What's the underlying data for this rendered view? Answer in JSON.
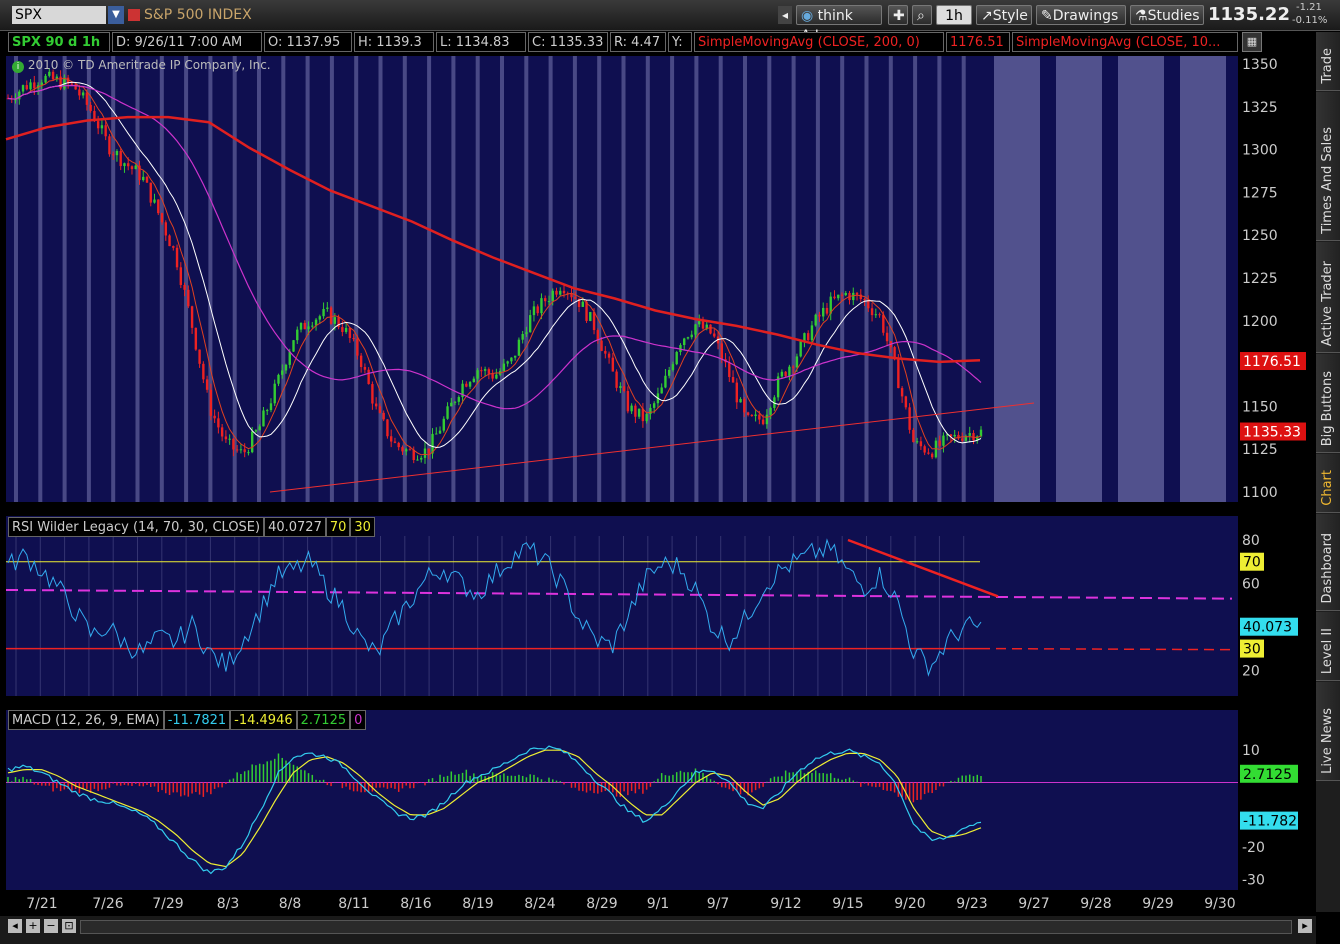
{
  "topbar": {
    "symbol": "SPX",
    "description": "S&P 500 INDEX",
    "think_ai": "think A.I.",
    "timeframe": "1h",
    "style": "Style",
    "drawings": "Drawings",
    "studies": "Studies",
    "last_price": "1135.22",
    "change": "-1.21",
    "change_pct": "-0.11%"
  },
  "info": {
    "title": "SPX 90 d 1h",
    "date": "D: 9/26/11 7:00 AM",
    "open": "O: 1137.95",
    "high": "H: 1139.3",
    "low": "L: 1134.83",
    "close": "C: 1135.33",
    "range": "R: 4.47",
    "y": "Y:",
    "sma200": "SimpleMovingAvg (CLOSE, 200, 0)",
    "sma200_val": "1176.51",
    "sma_other": "SimpleMovingAvg (CLOSE, 10..."
  },
  "copyright": "2010 © TD Ameritrade IP Company, Inc.",
  "rsi_header": {
    "label": "RSI Wilder Legacy (14, 70, 30, CLOSE)",
    "value": "40.0727",
    "ob": "70",
    "os": "30"
  },
  "macd_header": {
    "label": "MACD (12, 26, 9, EMA)",
    "v1": "-11.7821",
    "v2": "-14.4946",
    "v3": "2.7125",
    "v4": "0"
  },
  "sidebar_tabs": [
    "Trade",
    "Times And Sales",
    "Active Trader",
    "Big Buttons",
    "Chart",
    "Dashboard",
    "Level II",
    "Live News"
  ],
  "colors": {
    "panel_bg": "#0f0f50",
    "up": "#33cc33",
    "down": "#ee2222",
    "sma200": "#e02020",
    "sma_fast": "#ffffff",
    "sma_mid": "#cc33cc",
    "rsi": "#33aaee",
    "macd": "#33ccee",
    "signal": "#eeee33"
  },
  "chart_data": [
    {
      "type": "candlestick",
      "title": "SPX 90 d 1h",
      "x": [
        "7/21",
        "7/26",
        "7/29",
        "8/3",
        "8/8",
        "8/11",
        "8/16",
        "8/19",
        "8/24",
        "8/29",
        "9/1",
        "9/7",
        "9/12",
        "9/15",
        "9/20",
        "9/23",
        "9/27",
        "9/28",
        "9/29",
        "9/30"
      ],
      "ylim": [
        1100,
        1350
      ],
      "yticks": [
        1100,
        1125,
        1150,
        1175,
        1200,
        1225,
        1250,
        1275,
        1300,
        1325,
        1350
      ],
      "series": [
        {
          "name": "Close",
          "values": [
            1330,
            1337,
            1342,
            1340,
            1336,
            1322,
            1302,
            1292,
            1284,
            1262,
            1238,
            1196,
            1150,
            1128,
            1122,
            1138,
            1162,
            1190,
            1201,
            1204,
            1196,
            1178,
            1146,
            1128,
            1123,
            1124,
            1142,
            1162,
            1172,
            1168,
            1176,
            1200,
            1212,
            1222,
            1212,
            1196,
            1170,
            1149,
            1142,
            1160,
            1188,
            1198,
            1192,
            1168,
            1141,
            1143,
            1166,
            1180,
            1198,
            1210,
            1216,
            1212,
            1202,
            1168,
            1128,
            1124,
            1130,
            1134,
            1135
          ]
        },
        {
          "name": "SimpleMovingAvg (CLOSE, 200, 0)",
          "values": [
            1306,
            1313,
            1317,
            1319,
            1319,
            1316,
            1301,
            1288,
            1276,
            1267,
            1258,
            1247,
            1237,
            1228,
            1219,
            1213,
            1206,
            1201,
            1197,
            1192,
            1186,
            1181,
            1178,
            1176,
            1177
          ]
        }
      ],
      "annotations": [
        {
          "type": "trendline",
          "from": [
            "8/8",
            1100
          ],
          "to": [
            "9/27",
            1152
          ]
        },
        {
          "label": "1176.51"
        },
        {
          "label": "1135.33"
        }
      ]
    },
    {
      "type": "line",
      "title": "RSI Wilder Legacy (14, 70, 30, CLOSE)",
      "ylim": [
        10,
        80
      ],
      "yticks": [
        20,
        60,
        80
      ],
      "series": [
        {
          "name": "RSI",
          "values": [
            68,
            73,
            66,
            58,
            47,
            36,
            40,
            32,
            28,
            35,
            33,
            41,
            28,
            22,
            34,
            47,
            63,
            66,
            70,
            58,
            49,
            34,
            27,
            42,
            52,
            63,
            67,
            60,
            55,
            64,
            72,
            76,
            70,
            60,
            44,
            34,
            31,
            46,
            62,
            69,
            68,
            57,
            40,
            34,
            44,
            58,
            66,
            70,
            74,
            76,
            66,
            58,
            64,
            52,
            28,
            22,
            33,
            40,
            40
          ]
        }
      ],
      "levels": [
        {
          "label": "70",
          "value": 70
        },
        {
          "label": "30",
          "value": 30
        }
      ],
      "annotations": [
        {
          "label": "40.073"
        },
        {
          "type": "trendline",
          "from": [
            "9/15",
            80
          ],
          "to": [
            "9/26",
            54
          ]
        }
      ]
    },
    {
      "type": "line",
      "title": "MACD (12, 26, 9, EMA)",
      "ylim": [
        -32,
        15
      ],
      "yticks": [
        -30,
        -20,
        10
      ],
      "series": [
        {
          "name": "MACD",
          "values": [
            4,
            5,
            3,
            0,
            -3,
            -5,
            -6,
            -8,
            -10,
            -14,
            -19,
            -24,
            -28,
            -26,
            -19,
            -9,
            2,
            8,
            9,
            8,
            5,
            0,
            -5,
            -9,
            -11,
            -10,
            -6,
            -1,
            2,
            4,
            7,
            10,
            11,
            10,
            6,
            1,
            -4,
            -9,
            -12,
            -8,
            -2,
            3,
            4,
            0,
            -6,
            -8,
            -3,
            3,
            7,
            9,
            10,
            8,
            6,
            -1,
            -13,
            -18,
            -17,
            -14,
            -12
          ]
        },
        {
          "name": "Signal",
          "values": [
            3,
            4,
            4,
            2,
            -1,
            -3,
            -5,
            -7,
            -9,
            -12,
            -16,
            -21,
            -25,
            -26,
            -22,
            -14,
            -5,
            3,
            7,
            8,
            6,
            2,
            -3,
            -7,
            -10,
            -10,
            -8,
            -4,
            0,
            2,
            5,
            8,
            10,
            10,
            8,
            3,
            -1,
            -6,
            -10,
            -10,
            -5,
            0,
            3,
            2,
            -3,
            -7,
            -5,
            0,
            4,
            7,
            9,
            9,
            7,
            2,
            -8,
            -15,
            -17,
            -16,
            -14
          ]
        }
      ],
      "annotations": [
        {
          "label": "2.7125"
        },
        {
          "label": "-11.782"
        }
      ]
    }
  ]
}
